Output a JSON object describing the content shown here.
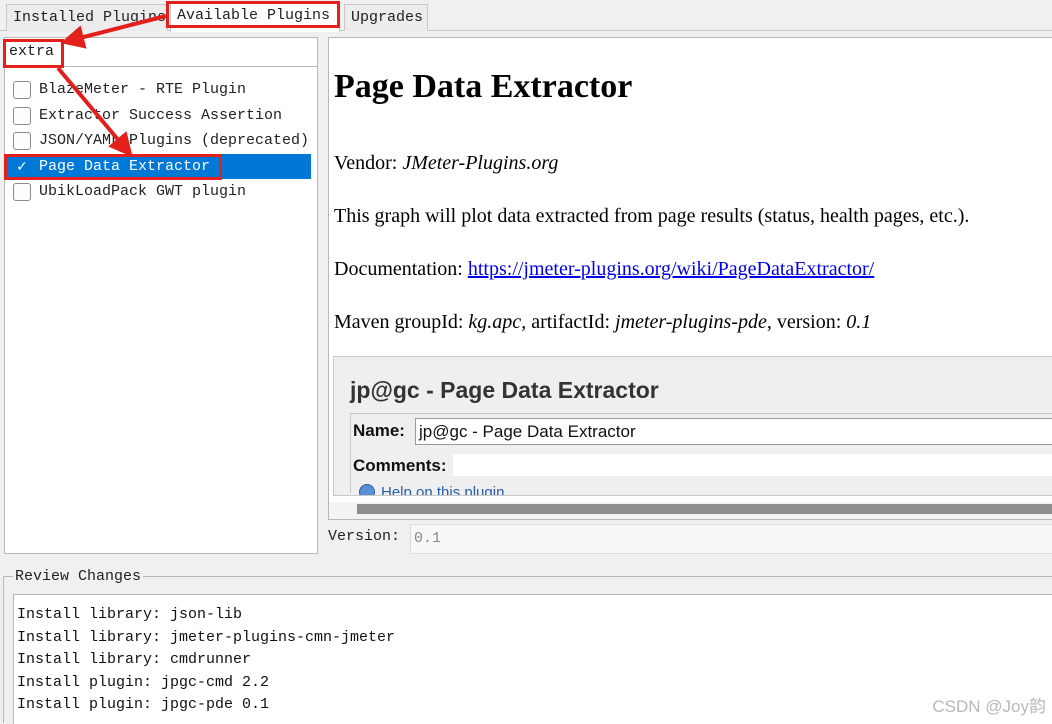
{
  "tabs": [
    {
      "label": "Installed Plugins"
    },
    {
      "label": "Available Plugins"
    },
    {
      "label": "Upgrades"
    }
  ],
  "search": {
    "value": "extra"
  },
  "plugins": [
    {
      "label": "BlazeMeter - RTE Plugin",
      "checked": false
    },
    {
      "label": "Extractor Success Assertion",
      "checked": false
    },
    {
      "label": "JSON/YAML Plugins (deprecated)",
      "checked": false
    },
    {
      "label": "Page Data Extractor",
      "checked": true,
      "selected": true
    },
    {
      "label": "UbikLoadPack GWT plugin",
      "checked": false
    }
  ],
  "detail": {
    "title": "Page Data Extractor",
    "vendor_label": "Vendor: ",
    "vendor_value": "JMeter-Plugins.org",
    "description": "This graph will plot data extracted from page results (status, health pages, etc.).",
    "doc_label": "Documentation: ",
    "doc_link": "https://jmeter-plugins.org/wiki/PageDataExtractor/",
    "maven_label": "Maven groupId: ",
    "maven_group": "kg.apc",
    "artifact_label": ", artifactId: ",
    "artifact_value": "jmeter-plugins-pde",
    "version_label": ", version: ",
    "version_value": "0.1",
    "preview": {
      "title": "jp@gc - Page Data Extractor",
      "name_label": "Name:",
      "name_value": "jp@gc - Page Data Extractor",
      "comments_label": "Comments:",
      "help_text": "Help on this plugin"
    }
  },
  "version": {
    "label": "Version:",
    "value": "0.1"
  },
  "review": {
    "legend": "Review Changes",
    "items": [
      "Install library: json-lib",
      "Install library: jmeter-plugins-cmn-jmeter",
      "Install library: cmdrunner",
      "Install plugin: jpgc-cmd 2.2",
      "Install plugin: jpgc-pde 0.1"
    ]
  },
  "watermark": "CSDN @Joy韵",
  "colors": {
    "selection": "#0078d7",
    "annotation": "#e3201b",
    "link": "#0000ee"
  }
}
